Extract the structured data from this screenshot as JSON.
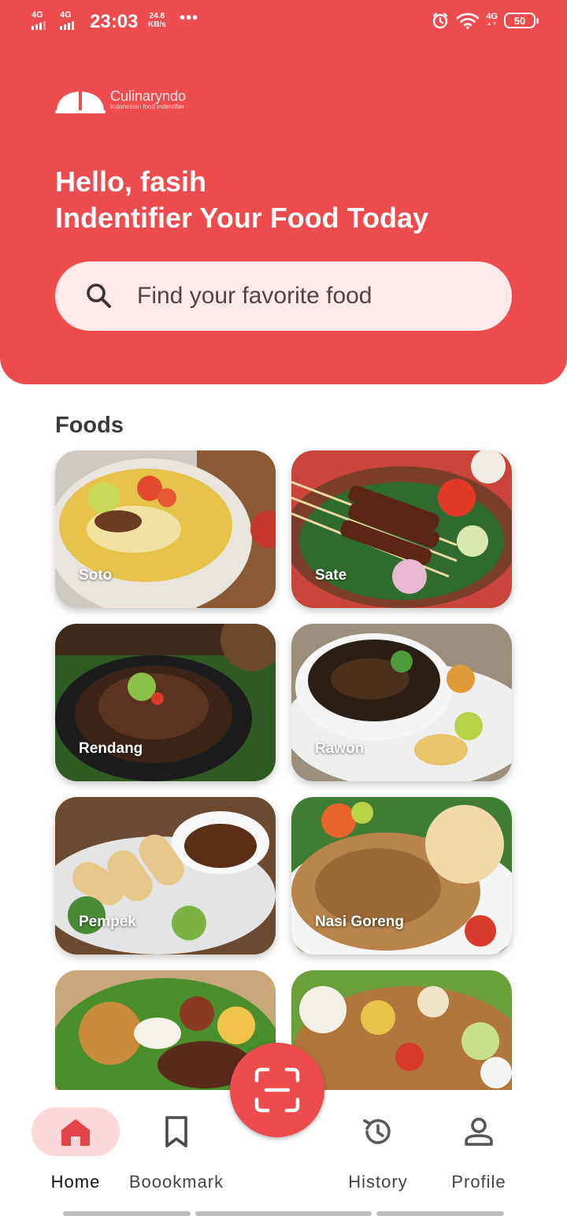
{
  "status_bar": {
    "sim1": "4G",
    "sim2": "4G",
    "time": "23:03",
    "speed_value": "24.8",
    "speed_unit": "KB/s",
    "more": "•••",
    "net_right": "4G",
    "battery": "50"
  },
  "app": {
    "logo_name": "Culinaryndo",
    "logo_tagline": "Indonesian food indentifier"
  },
  "greeting": {
    "line1": "Hello, fasih",
    "line2": "Indentifier Your Food Today"
  },
  "search": {
    "placeholder": "Find your favorite food",
    "icon": "search-icon"
  },
  "section_title": "Foods",
  "foods": [
    {
      "name": "Soto",
      "icon": "soto-image"
    },
    {
      "name": "Sate",
      "icon": "sate-image"
    },
    {
      "name": "Rendang",
      "icon": "rendang-image"
    },
    {
      "name": "Rawon",
      "icon": "rawon-image"
    },
    {
      "name": "Pempek",
      "icon": "pempek-image"
    },
    {
      "name": "Nasi Goreng",
      "icon": "nasi-goreng-image"
    },
    {
      "name": "",
      "icon": "nasi-uduk-image"
    },
    {
      "name": "",
      "icon": "gado-gado-image"
    }
  ],
  "nav": {
    "items": [
      {
        "label": "Home",
        "icon": "home-icon",
        "active": true
      },
      {
        "label": "Boookmark",
        "icon": "bookmark-icon",
        "active": false
      },
      {
        "label": "History",
        "icon": "history-icon",
        "active": false
      },
      {
        "label": "Profile",
        "icon": "profile-icon",
        "active": false
      }
    ],
    "scan_icon": "scan-icon"
  },
  "colors": {
    "primary": "#ee4b4d",
    "search_bg": "#fde9ea",
    "active_pill": "#fcd7d8"
  }
}
